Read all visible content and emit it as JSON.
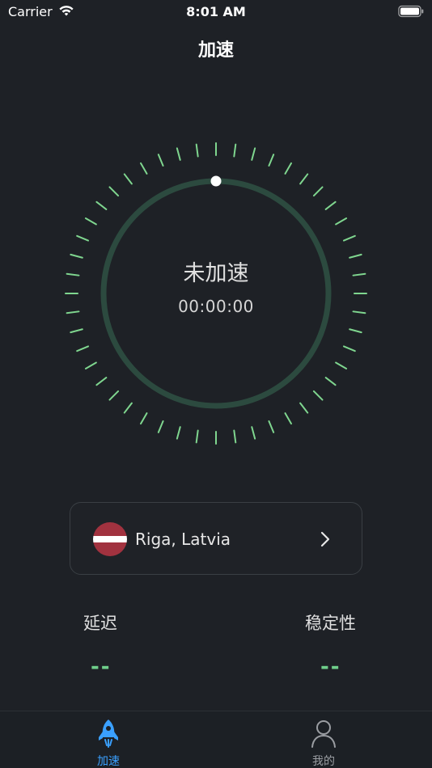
{
  "status_bar": {
    "carrier": "Carrier",
    "time": "8:01 AM"
  },
  "nav": {
    "title": "加速"
  },
  "dial": {
    "status": "未加速",
    "timer": "00:00:00",
    "ring_color": "#2c4a3f",
    "tick_color": "#7fd68f",
    "progress": 0
  },
  "server": {
    "name": "Riga, Latvia",
    "flag_icon": "latvia-flag-icon"
  },
  "metrics": {
    "latency_label": "延迟",
    "latency_value": "--",
    "stability_label": "稳定性",
    "stability_value": "--"
  },
  "tabs": [
    {
      "label": "加速",
      "icon": "rocket-icon",
      "active": true,
      "color": "#3aa0ff"
    },
    {
      "label": "我的",
      "icon": "person-icon",
      "active": false,
      "color": "#9a9da2"
    }
  ]
}
